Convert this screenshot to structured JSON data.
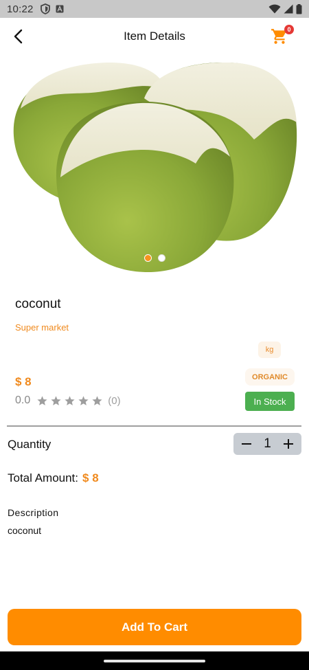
{
  "status_bar": {
    "time": "10:22"
  },
  "header": {
    "title": "Item Details",
    "cart_count": "0"
  },
  "product": {
    "name": "coconut",
    "store": "Super market",
    "unit": "kg",
    "tag": "ORGANIC",
    "price": "$ 8",
    "rating_value": "0.0",
    "rating_stars": 0,
    "rating_count": "(0)",
    "stock_status": "In Stock",
    "image_count": 2,
    "active_image_index": 0
  },
  "quantity": {
    "label": "Quantity",
    "value": "1"
  },
  "total": {
    "label": "Total Amount:",
    "value": "$ 8"
  },
  "description": {
    "title": "Description",
    "text": "coconut"
  },
  "actions": {
    "add_to_cart_label": "Add To Cart"
  },
  "colors": {
    "accent": "#ff8c00",
    "price": "#f08a1e",
    "in_stock": "#4caf50",
    "badge": "#e53935"
  }
}
